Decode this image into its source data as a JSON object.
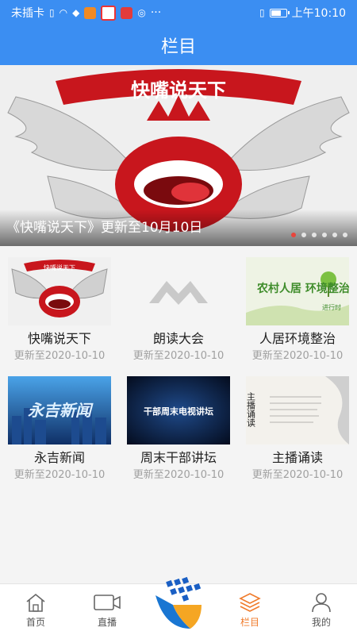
{
  "status_bar": {
    "carrier": "未插卡",
    "time": "上午10:10",
    "more": "···"
  },
  "header": {
    "title": "栏目"
  },
  "banner": {
    "caption": "《快嘴说天下》更新至10月10日",
    "image_text": "快嘴说天下",
    "dots": 6,
    "active_dot": 0
  },
  "columns": [
    {
      "title": "快嘴说天下",
      "updated": "更新至2020-10-10",
      "thumb": "mouth"
    },
    {
      "title": "朗读大会",
      "updated": "更新至2020-10-10",
      "thumb": "logo"
    },
    {
      "title": "人居环境整治",
      "updated": "更新至2020-10-10",
      "thumb": "green",
      "thumb_text": "农村人居 环境整治",
      "thumb_text2": "进行时"
    },
    {
      "title": "永吉新闻",
      "updated": "更新至2020-10-10",
      "thumb": "city",
      "thumb_text": "永吉新闻"
    },
    {
      "title": "周末干部讲坛",
      "updated": "更新至2020-10-10",
      "thumb": "dark",
      "thumb_text": "干部周末电视讲坛"
    },
    {
      "title": "主播诵读",
      "updated": "更新至2020-10-10",
      "thumb": "ink",
      "thumb_text": "主播诵读"
    }
  ],
  "nav": {
    "home": "首页",
    "live": "直播",
    "columns": "栏目",
    "mine": "我的",
    "active": "columns"
  },
  "colors": {
    "primary": "#3b8ef2",
    "active_nav": "#f07b2b",
    "active_dot": "#e8453c"
  }
}
